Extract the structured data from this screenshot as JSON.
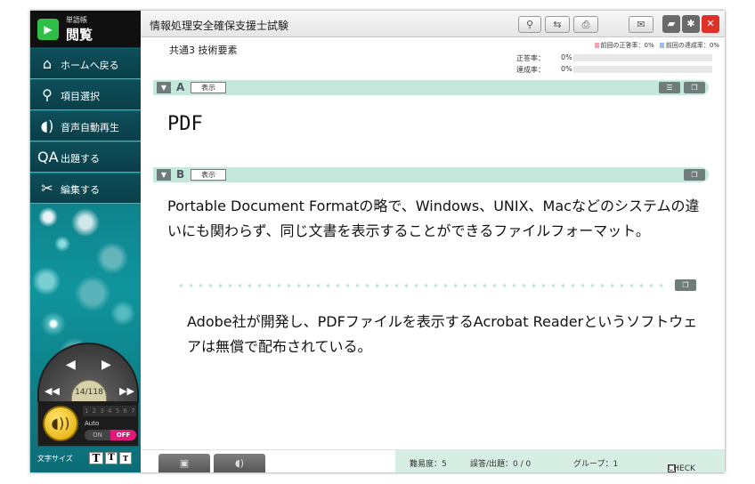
{
  "sidebar": {
    "logo_small": "単語帳",
    "logo_big": "閲覧",
    "items": [
      {
        "label": "ホームへ戻る",
        "icon": "home-icon"
      },
      {
        "label": "項目選択",
        "icon": "pointer-icon"
      },
      {
        "label": "音声自動再生",
        "icon": "speaker-icon"
      },
      {
        "label": "出題する",
        "icon": "quiz-icon"
      },
      {
        "label": "編集する",
        "icon": "scissors-icon"
      }
    ],
    "page_counter": "14/118",
    "speed_scale": "1 2 3 4 5 6 7",
    "auto_label": "Auto",
    "on_label": "ON",
    "off_label": "OFF",
    "font_size_label": "文字サイズ",
    "font_sizes": [
      "T",
      "T",
      "T"
    ]
  },
  "header": {
    "title": "情報処理安全確保支援士試験"
  },
  "section_name": "共通3 技術要素",
  "stats": {
    "legend_prev_correct": "前回の正答率：",
    "legend_prev_correct_value": "0%",
    "legend_prev_achieve": "前回の達成率：",
    "legend_prev_achieve_value": "0%",
    "correct_label": "正答率：",
    "correct_value": "0%",
    "correct_fraction": 0,
    "achieve_label": "達成率：",
    "achieve_value": "0%",
    "achieve_fraction": 0
  },
  "section_a": {
    "letter": "A",
    "show_label": "表示",
    "term": "PDF"
  },
  "section_b": {
    "letter": "B",
    "show_label": "表示",
    "definition": "Portable Document Formatの略で、Windows、UNIX、Macなどのシステムの違いにも関わらず、同じ文書を表示することができるファイルフォーマット。",
    "note": "Adobe社が開発し、PDFファイルを表示するAcrobat Readerというソフトウェアは無償で配布されている。"
  },
  "footer": {
    "difficulty": "難易度：5",
    "errors": "誤答/出題：0 / 0",
    "group": "グループ：1",
    "check_label": "CHECK"
  },
  "colors": {
    "accent_mint": "#c4e9dc",
    "sidebar_teal": "#0e7f88",
    "close_red": "#e0302a",
    "off_pink": "#e0187a",
    "legend_prev_correct": "#f5a0b0",
    "legend_prev_achieve": "#a0b8f0"
  }
}
